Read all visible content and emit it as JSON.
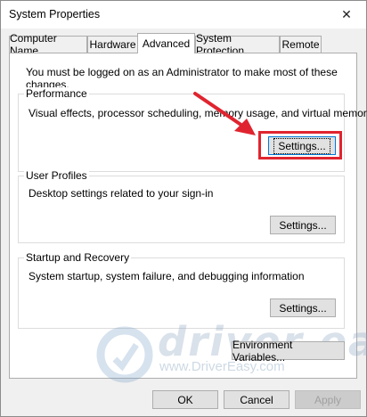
{
  "window": {
    "title": "System Properties",
    "close_glyph": "✕"
  },
  "tabs": [
    {
      "label": "Computer Name"
    },
    {
      "label": "Hardware"
    },
    {
      "label": "Advanced",
      "selected": true
    },
    {
      "label": "System Protection"
    },
    {
      "label": "Remote"
    }
  ],
  "advanced": {
    "admin_note": "You must be logged on as an Administrator to make most of these changes.",
    "performance": {
      "label": "Performance",
      "description": "Visual effects, processor scheduling, memory usage, and virtual memory",
      "settings_label": "Settings..."
    },
    "user_profiles": {
      "label": "User Profiles",
      "description": "Desktop settings related to your sign-in",
      "settings_label": "Settings..."
    },
    "startup_recovery": {
      "label": "Startup and Recovery",
      "description": "System startup, system failure, and debugging information",
      "settings_label": "Settings..."
    },
    "env_vars_label": "Environment Variables..."
  },
  "footer": {
    "ok": "OK",
    "cancel": "Cancel",
    "apply": "Apply"
  },
  "watermark": {
    "brand": "driver easy",
    "url": "www.DriverEasy.com"
  },
  "annotation": {
    "highlight_color": "#e0242f",
    "arrow_color": "#e0242f"
  },
  "icons": {
    "close": "close-icon",
    "arrow": "red-arrow-icon",
    "logo": "drivereasy-logo-icon"
  }
}
